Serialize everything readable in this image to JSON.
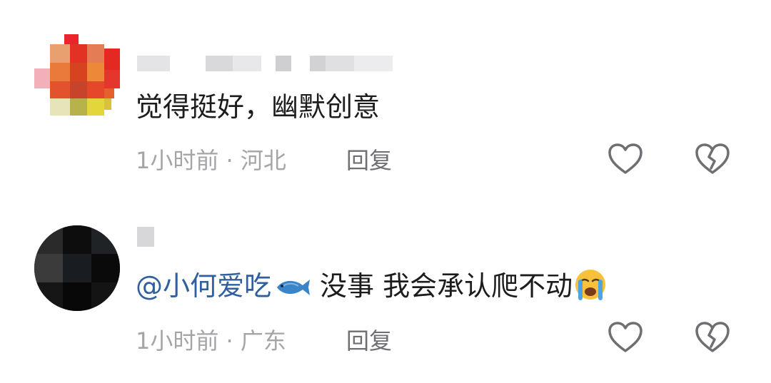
{
  "comments": [
    {
      "text": "觉得挺好，幽默创意",
      "time": "1小时前",
      "location": "河北",
      "reply_label": "回复"
    },
    {
      "mention": "@小何爱吃",
      "mention_icon": "fish-emoji",
      "text": "没事 我会承认爬不动",
      "text_icon": "crying-face-emoji",
      "time": "1小时前",
      "location": "广东",
      "reply_label": "回复"
    }
  ],
  "separator": " · ",
  "colors": {
    "mention": "#2f5f9e",
    "meta": "#a5a5a8",
    "reply": "#6f6f73",
    "icon_outline": "#6f6f73"
  }
}
